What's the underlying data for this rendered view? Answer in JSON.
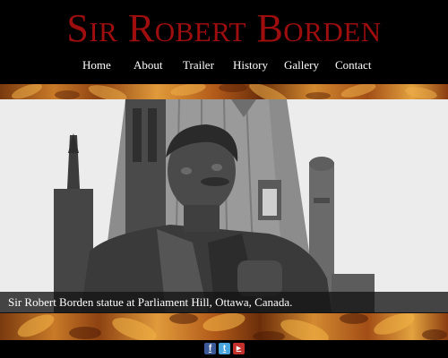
{
  "header": {
    "title": "Sir Robert Borden"
  },
  "nav": {
    "items": [
      {
        "label": "Home"
      },
      {
        "label": "About"
      },
      {
        "label": "Trailer"
      },
      {
        "label": "History"
      },
      {
        "label": "Gallery"
      },
      {
        "label": "Contact"
      }
    ]
  },
  "hero": {
    "caption": "Sir Robert Borden statue at Parliament Hill, Ottawa, Canada."
  },
  "social": {
    "icons": [
      {
        "name": "facebook-icon",
        "glyph": "f",
        "color": "#3b5998"
      },
      {
        "name": "twitter-icon",
        "glyph": "t",
        "color": "#4aa4de"
      },
      {
        "name": "youtube-icon",
        "glyph": "▶",
        "color": "#c4302b"
      }
    ]
  },
  "colors": {
    "title": "#9e0e0e",
    "background": "#000000",
    "nav_text": "#ffffff"
  }
}
